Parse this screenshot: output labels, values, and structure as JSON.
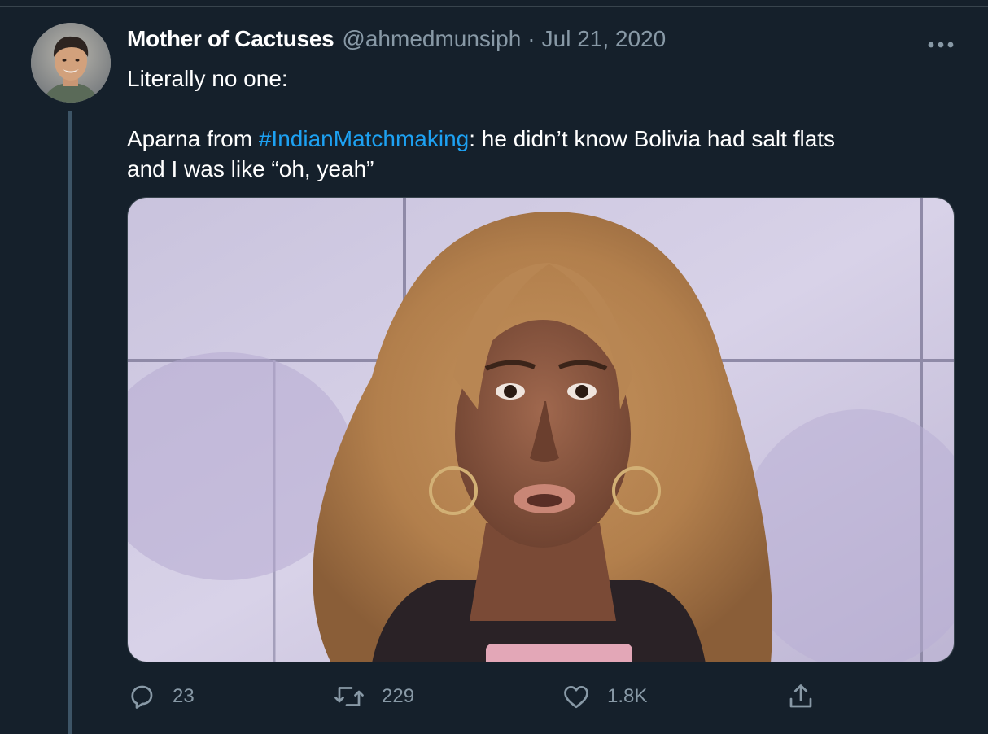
{
  "tweet": {
    "author": {
      "display_name": "Mother of Cactuses",
      "handle": "@ahmedmunsiph"
    },
    "separator": "·",
    "date": "Jul 21, 2020",
    "text": {
      "line1": "Literally no one:",
      "line2_prefix": "Aparna from ",
      "hashtag": "#IndianMatchmaking",
      "line2_suffix": ": he didn’t know Bolivia had salt flats",
      "line3": "and I was like “oh, yeah”"
    },
    "actions": {
      "replies": "23",
      "retweets": "229",
      "likes": "1.8K"
    }
  },
  "icons": {
    "more": "more-horizontal-icon",
    "reply": "reply-icon",
    "retweet": "retweet-icon",
    "like": "heart-icon",
    "share": "share-icon"
  },
  "colors": {
    "background": "#15202b",
    "text": "#ffffff",
    "secondary": "#8899a6",
    "link": "#1da1f2",
    "border": "#38444d",
    "thread_line": "#3d5466"
  }
}
